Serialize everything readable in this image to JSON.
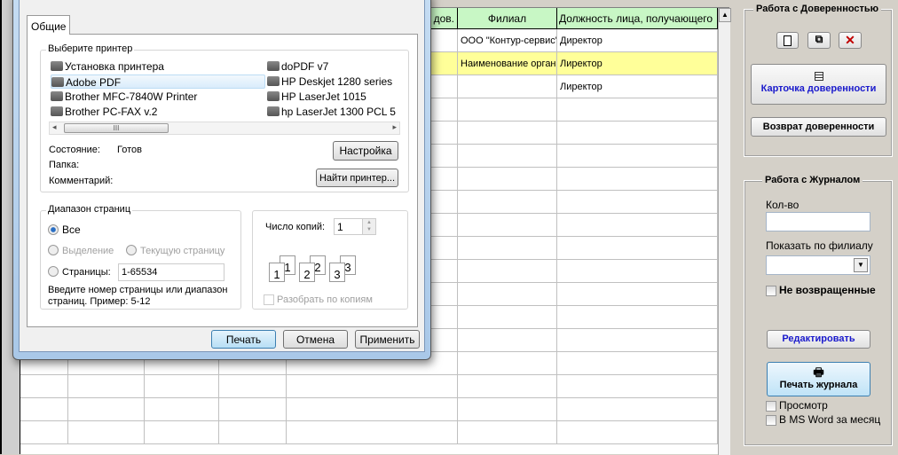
{
  "grid": {
    "headers": [
      "",
      "",
      "",
      "",
      "дов.",
      "Филиал",
      "Должность лица, получающего"
    ],
    "rows": [
      [
        "",
        "",
        "",
        "",
        "",
        "ООО \"Контур-сервис\"",
        "Директор"
      ],
      [
        "",
        "",
        "",
        "",
        "",
        "Наименование организации",
        "Лиректор"
      ],
      [
        "",
        "",
        "",
        "",
        "",
        "",
        "Лиректор"
      ]
    ],
    "highlight_color": "#ffff99",
    "header_color": "#c8f7c5"
  },
  "panel1": {
    "title": "Работа с Доверенностью",
    "card_button": "Карточка доверенности",
    "return_button": "Возврат доверенности"
  },
  "panel2": {
    "title": "Работа с Журналом",
    "qty_label": "Кол-во",
    "qty_value": "",
    "branch_label": "Показать по филиалу",
    "not_returned": "Не возвращенные",
    "edit_button": "Редактировать",
    "print_button": "Печать журнала",
    "preview": "Просмотр",
    "msword": "В MS Word за месяц"
  },
  "dialog": {
    "tab": "Общие",
    "printer_group": "Выберите принтер",
    "printers": [
      "Установка принтера",
      "Adobe PDF",
      "Brother MFC-7840W Printer",
      "Brother PC-FAX v.2",
      "doPDF v7",
      "HP Deskjet 1280 series",
      "HP LaserJet 1015",
      "hp LaserJet 1300 PCL 5"
    ],
    "selected_printer": "Adobe PDF",
    "scroll_thumb": "III",
    "status_label": "Состояние:",
    "status_value": "Готов",
    "folder_label": "Папка:",
    "comment_label": "Комментарий:",
    "setup_button": "Настройка",
    "find_button": "Найти принтер...",
    "range_group": "Диапазон страниц",
    "all": "Все",
    "selection": "Выделение",
    "current": "Текущую страницу",
    "pages": "Страницы:",
    "pages_value": "1-65534",
    "hint1": "Введите номер страницы или диапазон",
    "hint2": "страниц.  Пример: 5-12",
    "copies_label": "Число копий:",
    "copies_value": "1",
    "collate": "Разобрать по копиям",
    "page_nums": [
      "1",
      "1",
      "2",
      "2",
      "3",
      "3"
    ],
    "print": "Печать",
    "cancel": "Отмена",
    "apply": "Применить"
  }
}
